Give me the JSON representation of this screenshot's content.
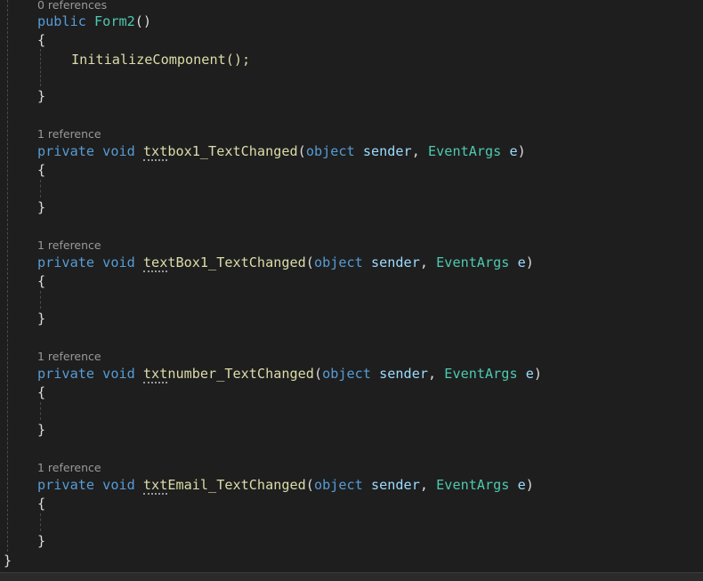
{
  "editor": {
    "blocks": [
      {
        "codelens": "0 references",
        "modifier": "public",
        "return_type": "",
        "name_lead": "",
        "name_rest": "Form2",
        "params": [],
        "body": "InitializeComponent();"
      },
      {
        "codelens": "1 reference",
        "modifier": "private",
        "return_type": "void",
        "name_lead": "txt",
        "name_rest": "box1_TextChanged",
        "params": [
          "object",
          "sender",
          "EventArgs",
          "e"
        ],
        "body": ""
      },
      {
        "codelens": "1 reference",
        "modifier": "private",
        "return_type": "void",
        "name_lead": "tex",
        "name_rest": "tBox1_TextChanged",
        "params": [
          "object",
          "sender",
          "EventArgs",
          "e"
        ],
        "body": ""
      },
      {
        "codelens": "1 reference",
        "modifier": "private",
        "return_type": "void",
        "name_lead": "txt",
        "name_rest": "number_TextChanged",
        "params": [
          "object",
          "sender",
          "EventArgs",
          "e"
        ],
        "body": ""
      },
      {
        "codelens": "1 reference",
        "modifier": "private",
        "return_type": "void",
        "name_lead": "txt",
        "name_rest": "Email_TextChanged",
        "params": [
          "object",
          "sender",
          "EventArgs",
          "e"
        ],
        "body": ""
      }
    ],
    "open_brace": "{",
    "close_brace": "}",
    "class_close_brace": "}"
  },
  "colors": {
    "background": "#1e1e1e",
    "keyword": "#569cd6",
    "type": "#4ec9b0",
    "method": "#dcdcaa",
    "parameter": "#9cdcfe",
    "codelens": "#999999"
  }
}
